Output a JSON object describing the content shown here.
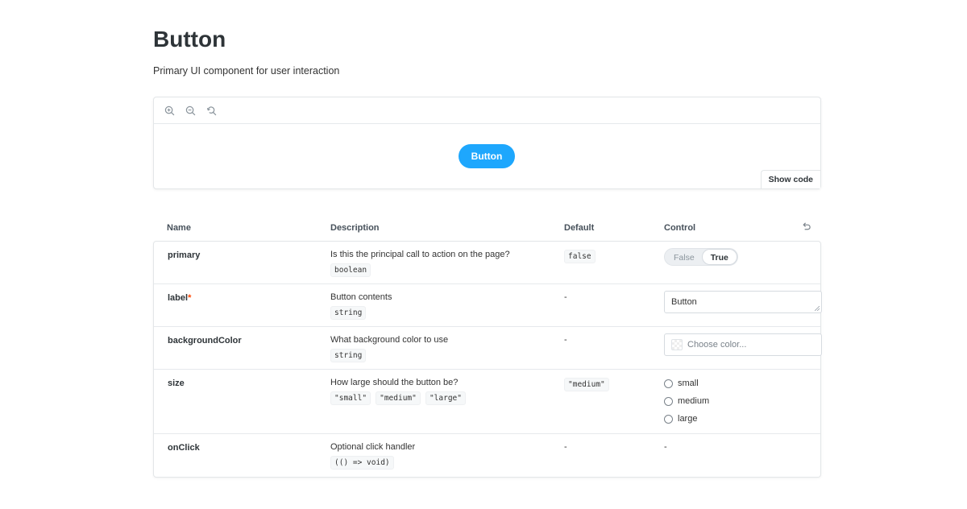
{
  "page": {
    "title": "Button",
    "subtitle": "Primary UI component for user interaction"
  },
  "preview": {
    "toolbar": {
      "zoom_in_icon": "zoom-in-icon",
      "zoom_out_icon": "zoom-out-icon",
      "zoom_reset_icon": "zoom-reset-icon"
    },
    "demo_button_label": "Button",
    "demo_button_color": "#1ea7fd",
    "show_code_label": "Show code"
  },
  "args_table": {
    "headers": {
      "name": "Name",
      "description": "Description",
      "default": "Default",
      "control": "Control"
    },
    "rows": [
      {
        "name": "primary",
        "required": false,
        "description": "Is this the principal call to action on the page?",
        "types": [
          "boolean"
        ],
        "default": "false",
        "control": {
          "type": "toggle",
          "options": [
            "False",
            "True"
          ],
          "selected": "True"
        }
      },
      {
        "name": "label",
        "required": true,
        "required_marker": "*",
        "description": "Button contents",
        "types": [
          "string"
        ],
        "default": "-",
        "control": {
          "type": "text",
          "value": "Button"
        }
      },
      {
        "name": "backgroundColor",
        "required": false,
        "description": "What background color to use",
        "types": [
          "string"
        ],
        "default": "-",
        "control": {
          "type": "color",
          "placeholder": "Choose color..."
        }
      },
      {
        "name": "size",
        "required": false,
        "description": "How large should the button be?",
        "types": [
          "\"small\"",
          "\"medium\"",
          "\"large\""
        ],
        "default": "\"medium\"",
        "control": {
          "type": "radio",
          "options": [
            "small",
            "medium",
            "large"
          ],
          "selected": null
        }
      },
      {
        "name": "onClick",
        "required": false,
        "description": "Optional click handler",
        "types": [
          "(() => void)"
        ],
        "default": "-",
        "control": {
          "type": "none",
          "value": "-"
        }
      }
    ]
  }
}
